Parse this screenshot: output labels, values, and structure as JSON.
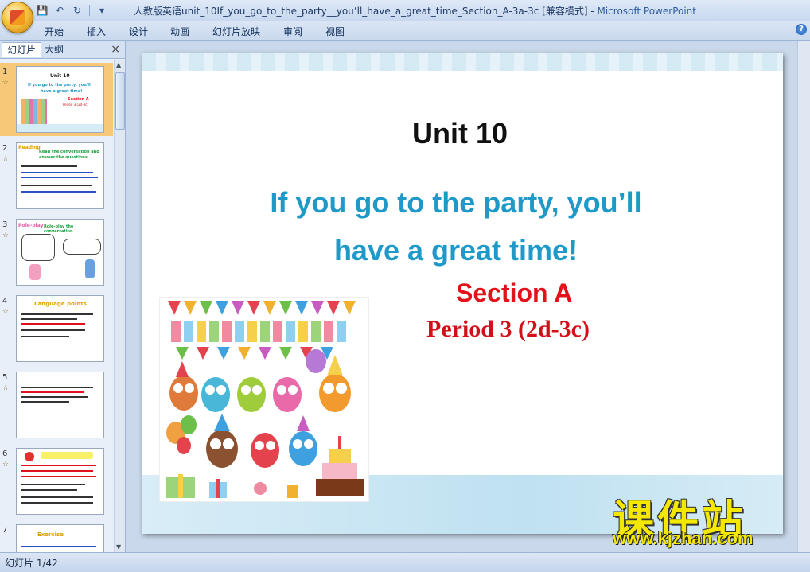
{
  "window": {
    "title": "人教版英语unit_10If_you_go_to_the_party__you’ll_have_a_great_time_Section_A-3a-3c [兼容模式]",
    "app_name": "Microsoft PowerPoint"
  },
  "quick_access": {
    "save_icon": "save-icon",
    "undo_icon": "undo-icon",
    "redo_icon": "redo-icon"
  },
  "ribbon": {
    "tabs": [
      "开始",
      "插入",
      "设计",
      "动画",
      "幻灯片放映",
      "审阅",
      "视图"
    ]
  },
  "panel": {
    "tab_slides": "幻灯片",
    "tab_outline": "大纲",
    "close": "×"
  },
  "thumbnails": [
    {
      "number": "1",
      "star": "☆",
      "heading": "Unit 10",
      "line1": "If you go to the party, you'll",
      "line2": "have a great time!",
      "line3": "Section A",
      "line4": "Period 3 (2d-3c)"
    },
    {
      "number": "2",
      "star": "☆",
      "heading": "Reading",
      "line1": "Read the conversation and",
      "line2": "answer the questions."
    },
    {
      "number": "3",
      "star": "☆",
      "heading": "Role-play",
      "line1": "Role-play the conversation."
    },
    {
      "number": "4",
      "star": "☆",
      "heading": "Language points",
      "line1": ""
    },
    {
      "number": "5",
      "star": "☆",
      "heading": "",
      "line1": ""
    },
    {
      "number": "6",
      "star": "☆",
      "heading": "",
      "line1": ""
    },
    {
      "number": "7",
      "star": "",
      "heading": "Exercise",
      "line1": ""
    }
  ],
  "slide": {
    "unit": "Unit 10",
    "title_line1": "If you go to the party, you’ll",
    "title_line2": "have a great time!",
    "section": "Section A",
    "period": "Period 3 (2d-3c)"
  },
  "watermark": {
    "text_cn": "课件站",
    "url": "www.kjzhan.com"
  },
  "status": {
    "slide_count": "幻灯片 1/42"
  },
  "colors": {
    "title_blue": "#1f9ac8",
    "section_red": "#e3121a",
    "selected_thumb": "#f7c878"
  }
}
